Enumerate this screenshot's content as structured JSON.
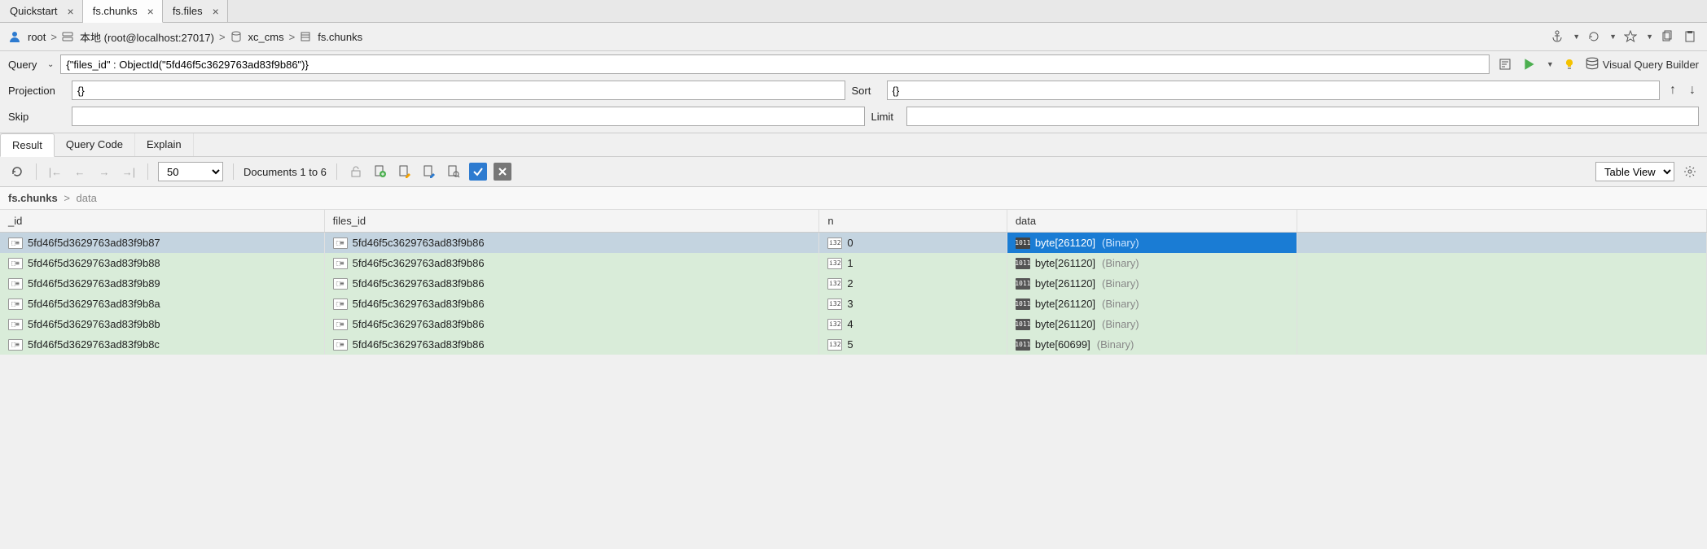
{
  "tabs": [
    {
      "label": "Quickstart",
      "active": false
    },
    {
      "label": "fs.chunks",
      "active": true
    },
    {
      "label": "fs.files",
      "active": false
    }
  ],
  "breadcrumb": {
    "root": "root",
    "conn": "本地 (root@localhost:27017)",
    "db": "xc_cms",
    "coll": "fs.chunks"
  },
  "query": {
    "label": "Query",
    "value": "{\"files_id\" : ObjectId(\"5fd46f5c3629763ad83f9b86\")}"
  },
  "projection": {
    "label": "Projection",
    "value": "{}"
  },
  "sort": {
    "label": "Sort",
    "value": "{}"
  },
  "skip": {
    "label": "Skip",
    "value": ""
  },
  "limit": {
    "label": "Limit",
    "value": ""
  },
  "visual_query_builder": "Visual Query Builder",
  "result_tabs": {
    "result": "Result",
    "query_code": "Query Code",
    "explain": "Explain"
  },
  "result_toolbar": {
    "page_size": "50",
    "range": "Documents 1 to 6",
    "view": "Table View"
  },
  "table_crumb": {
    "main": "fs.chunks",
    "sep": ">",
    "sub": "data"
  },
  "columns": {
    "id": "_id",
    "files_id": "files_id",
    "n": "n",
    "data": "data"
  },
  "rows": [
    {
      "_id": "5fd46f5d3629763ad83f9b87",
      "files_id": "5fd46f5c3629763ad83f9b86",
      "n": "0",
      "data": "byte[261120]",
      "dtype": "(Binary)",
      "selected_row": true,
      "selected_cell": true
    },
    {
      "_id": "5fd46f5d3629763ad83f9b88",
      "files_id": "5fd46f5c3629763ad83f9b86",
      "n": "1",
      "data": "byte[261120]",
      "dtype": "(Binary)"
    },
    {
      "_id": "5fd46f5d3629763ad83f9b89",
      "files_id": "5fd46f5c3629763ad83f9b86",
      "n": "2",
      "data": "byte[261120]",
      "dtype": "(Binary)"
    },
    {
      "_id": "5fd46f5d3629763ad83f9b8a",
      "files_id": "5fd46f5c3629763ad83f9b86",
      "n": "3",
      "data": "byte[261120]",
      "dtype": "(Binary)"
    },
    {
      "_id": "5fd46f5d3629763ad83f9b8b",
      "files_id": "5fd46f5c3629763ad83f9b86",
      "n": "4",
      "data": "byte[261120]",
      "dtype": "(Binary)"
    },
    {
      "_id": "5fd46f5d3629763ad83f9b8c",
      "files_id": "5fd46f5c3629763ad83f9b86",
      "n": "5",
      "data": "byte[60699]",
      "dtype": "(Binary)"
    }
  ]
}
